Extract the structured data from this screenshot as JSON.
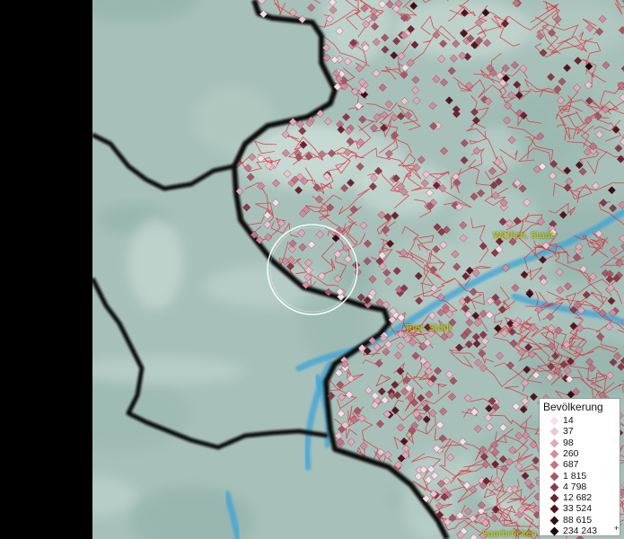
{
  "map": {
    "places": [
      {
        "name": "Wittlich, Stadt"
      },
      {
        "name": "Trier, Stadt"
      },
      {
        "name": "Saarbrücken"
      }
    ],
    "colors": {
      "terrain": "#a9c2bc",
      "border": "#111111",
      "municipal_lines": "#e0303a",
      "water": "#3aa4d8"
    }
  },
  "legend": {
    "title": "Bevölkerung",
    "items": [
      {
        "value": "14",
        "color": "#f6dfe9"
      },
      {
        "value": "37",
        "color": "#eec4d2"
      },
      {
        "value": "98",
        "color": "#e0a8b8"
      },
      {
        "value": "260",
        "color": "#d18d9e"
      },
      {
        "value": "687",
        "color": "#c07585"
      },
      {
        "value": "1 815",
        "color": "#a85865"
      },
      {
        "value": "4 798",
        "color": "#8c3a48"
      },
      {
        "value": "12 682",
        "color": "#6e2431"
      },
      {
        "value": "33 524",
        "color": "#531521"
      },
      {
        "value": "88 615",
        "color": "#3a0c14"
      },
      {
        "value": "234 243",
        "color": "#1e050a"
      }
    ],
    "more_symbol": "+"
  }
}
